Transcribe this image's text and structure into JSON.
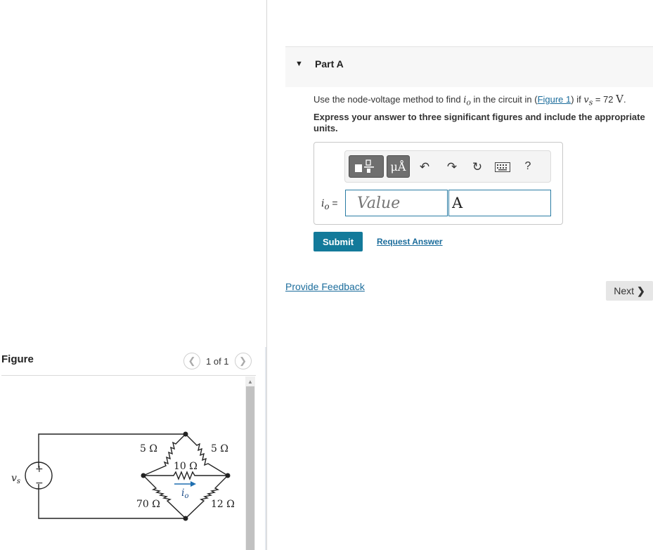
{
  "figure_panel": {
    "title": "Figure",
    "page_count": "1 of 1",
    "circuit": {
      "source_label": "v",
      "source_sub": "s",
      "plus": "+",
      "minus": "−",
      "r_top_left": "5 Ω",
      "r_top_right": "5 Ω",
      "r_middle": "10 Ω",
      "r_bottom_left": "70 Ω",
      "r_bottom_right": "12 Ω",
      "current_label": "i",
      "current_sub": "o"
    }
  },
  "part": {
    "caret": "▼",
    "title": "Part A",
    "question": {
      "prefix": "Use the node-voltage method to find ",
      "var": "i",
      "var_sub": "o",
      "mid": " in the circuit in (",
      "link": "Figure 1",
      "after_link": ") if ",
      "vs": "v",
      "vs_sub": "s",
      "equals": " = 72 ",
      "unit": "V",
      "end": "."
    },
    "instruction": "Express your answer to three significant figures and include the appropriate units."
  },
  "answer": {
    "label_var": "i",
    "label_sub": "o",
    "label_eq": " =",
    "value_placeholder": "Value",
    "unit_value": "A",
    "toolbar": {
      "units_button": "μÅ",
      "help": "?"
    }
  },
  "buttons": {
    "submit": "Submit",
    "request_answer": "Request Answer",
    "provide_feedback": "Provide Feedback",
    "next": "Next"
  }
}
